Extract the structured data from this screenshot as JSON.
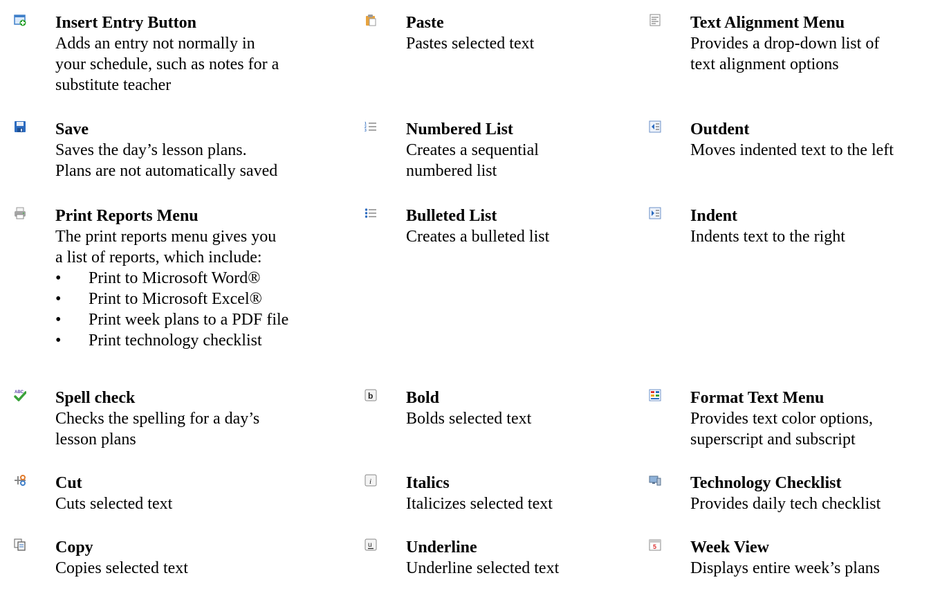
{
  "columns": [
    {
      "items": [
        {
          "icon": "insert-entry-icon",
          "title": "Insert Entry Button",
          "desc": [
            "Adds an entry not normally in",
            "your schedule, such as notes for a",
            "substitute teacher"
          ]
        },
        {
          "icon": "save-icon",
          "title": "Save",
          "desc": [
            "Saves the day’s lesson plans.",
            "Plans are not automatically saved"
          ]
        },
        {
          "icon": "printer-icon",
          "title": "Print Reports Menu",
          "desc": [
            "The print reports menu gives you",
            "a list of reports, which include:"
          ],
          "bullets": [
            "Print to Microsoft Word®",
            "Print to Microsoft Excel®",
            "Print week plans to a PDF file",
            "Print technology checklist"
          ]
        },
        {
          "icon": "spell-check-icon",
          "title": "Spell check",
          "desc": [
            "Checks the spelling for a day’s",
            "lesson plans"
          ]
        },
        {
          "icon": "scissors-icon",
          "title": "Cut",
          "desc": [
            "Cuts selected text"
          ]
        },
        {
          "icon": "copy-icon",
          "title": "Copy",
          "desc": [
            "Copies selected text"
          ]
        }
      ]
    },
    {
      "items": [
        {
          "icon": "clipboard-paste-icon",
          "title": "Paste",
          "desc": [
            "Pastes selected text"
          ]
        },
        {
          "icon": "numbered-list-icon",
          "title": "Numbered List",
          "desc": [
            "Creates a sequential",
            "numbered list"
          ]
        },
        {
          "icon": "bulleted-list-icon",
          "title": "Bulleted List",
          "desc": [
            "Creates a bulleted list"
          ]
        },
        {
          "icon": "bold-icon",
          "title": "Bold",
          "desc": [
            "Bolds selected text"
          ]
        },
        {
          "icon": "italic-icon",
          "title": "Italics",
          "desc": [
            "Italicizes selected text"
          ]
        },
        {
          "icon": "underline-icon",
          "title": "Underline",
          "desc": [
            "Underline selected text"
          ]
        }
      ]
    },
    {
      "items": [
        {
          "icon": "text-alignment-icon",
          "title": "Text Alignment Menu",
          "desc": [
            "Provides a drop-down list of",
            "text alignment options"
          ]
        },
        {
          "icon": "outdent-icon",
          "title": "Outdent",
          "desc": [
            "Moves indented text to the left"
          ]
        },
        {
          "icon": "indent-icon",
          "title": "Indent",
          "desc": [
            "Indents text to the right"
          ]
        },
        {
          "icon": "format-text-icon",
          "title": "Format Text Menu",
          "desc": [
            "Provides text color options,",
            "superscript and subscript"
          ]
        },
        {
          "icon": "technology-checklist-icon",
          "title": "Technology Checklist",
          "desc": [
            "Provides daily tech checklist"
          ]
        },
        {
          "icon": "week-view-icon",
          "title": "Week View",
          "desc": [
            "Displays entire week’s plans"
          ]
        }
      ]
    }
  ]
}
